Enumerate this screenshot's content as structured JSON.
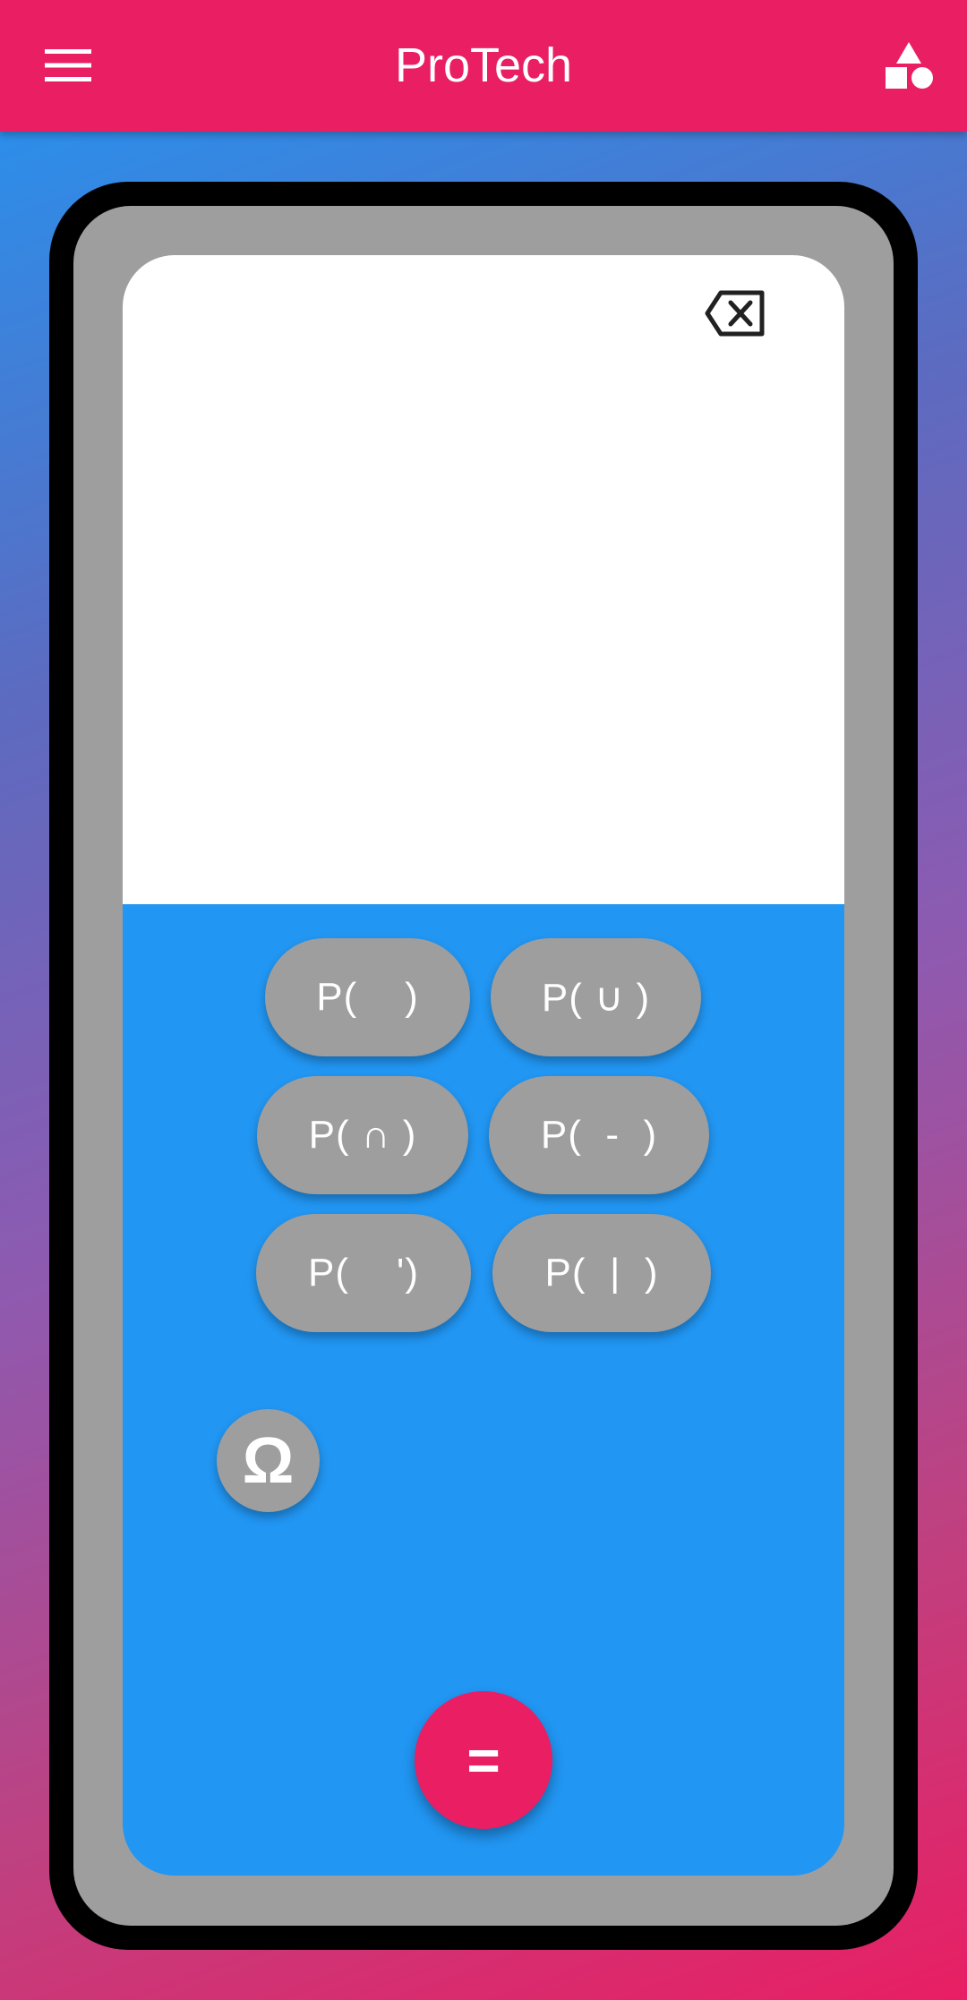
{
  "colors": {
    "primary": "#E91E63",
    "keypad_background": "#2196F3",
    "button_grey": "#9E9E9E",
    "display_background": "#FFFFFF",
    "device_frame": "#000000"
  },
  "app_bar": {
    "title": "ProTech",
    "menu_icon": "hamburger-menu-icon",
    "shapes_icon": "shapes-icon"
  },
  "display": {
    "expression": "",
    "backspace_icon": "backspace-icon"
  },
  "keypad": {
    "keys": [
      {
        "label": "P(    )"
      },
      {
        "label": "P( ∪ )"
      },
      {
        "label": "P( ∩ )"
      },
      {
        "label": "P(  -  )"
      },
      {
        "label": "P(    ')"
      },
      {
        "label": "P(  |  )"
      }
    ],
    "omega_label": "Ω",
    "equals_label": "="
  }
}
